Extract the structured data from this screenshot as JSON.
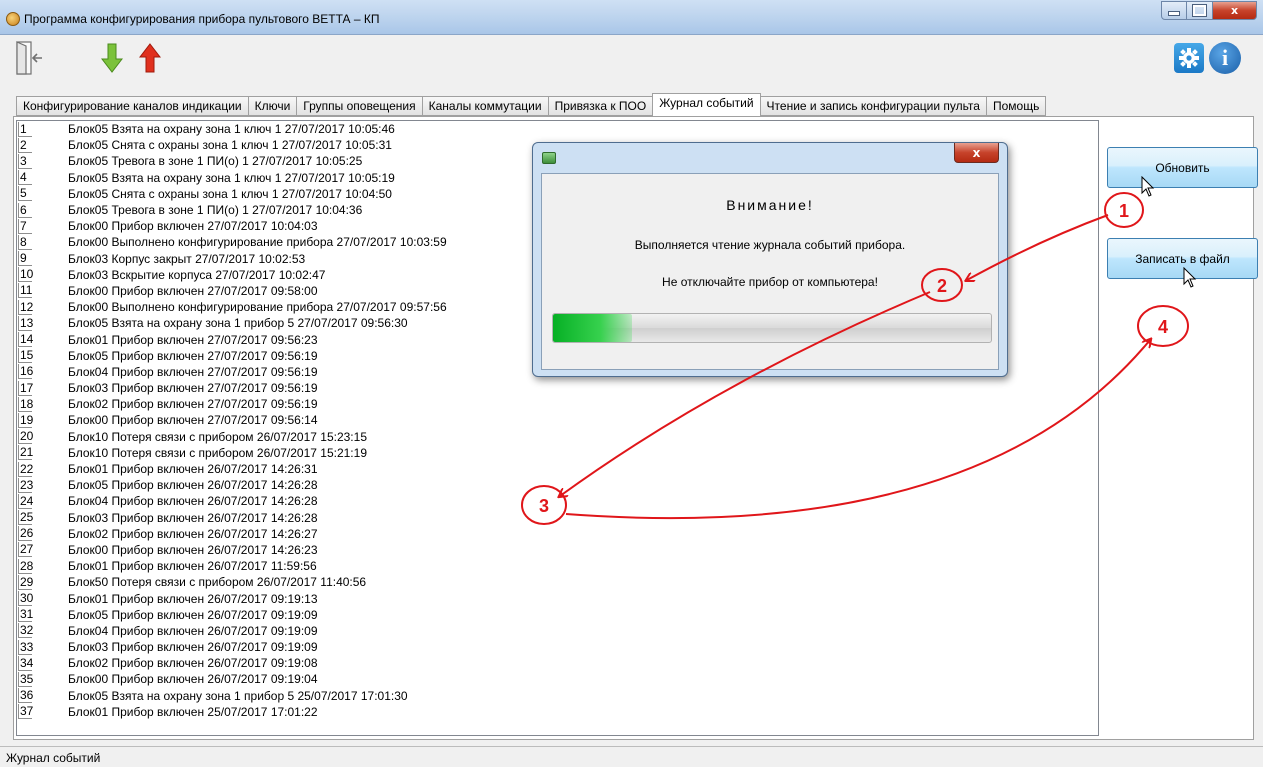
{
  "window": {
    "title": "Программа конфигурирования прибора пультового ВЕТТА – КП",
    "close_symbol": "x"
  },
  "toolbar": {
    "icons": [
      "exit-door-icon",
      "arrow-down-icon",
      "arrow-up-icon",
      "gear-icon",
      "info-icon"
    ],
    "info_symbol": "i",
    "down_color": "#7bc23a",
    "up_color": "#e0301e"
  },
  "tabs": [
    {
      "label": "Конфигурирование каналов индикации"
    },
    {
      "label": "Ключи"
    },
    {
      "label": "Группы оповещения"
    },
    {
      "label": "Каналы коммутации"
    },
    {
      "label": "Привязка к ПОО"
    },
    {
      "label": "Журнал событий",
      "active": true
    },
    {
      "label": "Чтение и запись конфигурации пульта"
    },
    {
      "label": "Помощь"
    }
  ],
  "events": [
    {
      "n": "1",
      "text": "Блок05 Взята на охрану зона 1 ключ 1 27/07/2017 10:05:46"
    },
    {
      "n": "2",
      "text": "Блок05 Снята с охраны зона 1 ключ 1 27/07/2017 10:05:31"
    },
    {
      "n": "3",
      "text": "Блок05 Тревога в зоне 1 ПИ(о) 1 27/07/2017 10:05:25"
    },
    {
      "n": "4",
      "text": "Блок05 Взята на охрану зона 1 ключ 1 27/07/2017 10:05:19"
    },
    {
      "n": "5",
      "text": "Блок05 Снята с охраны зона 1 ключ 1 27/07/2017 10:04:50"
    },
    {
      "n": "6",
      "text": "Блок05 Тревога в зоне 1 ПИ(о) 1 27/07/2017 10:04:36"
    },
    {
      "n": "7",
      "text": "Блок00 Прибор включен 27/07/2017 10:04:03"
    },
    {
      "n": "8",
      "text": "Блок00 Выполнено конфигурирование прибора 27/07/2017 10:03:59"
    },
    {
      "n": "9",
      "text": "Блок03 Корпус закрыт 27/07/2017 10:02:53"
    },
    {
      "n": "10",
      "text": "Блок03 Вскрытие корпуса 27/07/2017 10:02:47"
    },
    {
      "n": "11",
      "text": "Блок00 Прибор включен 27/07/2017 09:58:00"
    },
    {
      "n": "12",
      "text": "Блок00 Выполнено конфигурирование прибора 27/07/2017 09:57:56"
    },
    {
      "n": "13",
      "text": "Блок05 Взята на охрану зона 1 прибор 5 27/07/2017 09:56:30"
    },
    {
      "n": "14",
      "text": "Блок01 Прибор включен 27/07/2017 09:56:23"
    },
    {
      "n": "15",
      "text": "Блок05 Прибор включен 27/07/2017 09:56:19"
    },
    {
      "n": "16",
      "text": "Блок04 Прибор включен 27/07/2017 09:56:19"
    },
    {
      "n": "17",
      "text": "Блок03 Прибор включен 27/07/2017 09:56:19"
    },
    {
      "n": "18",
      "text": "Блок02 Прибор включен 27/07/2017 09:56:19"
    },
    {
      "n": "19",
      "text": "Блок00 Прибор включен 27/07/2017 09:56:14"
    },
    {
      "n": "20",
      "text": "Блок10 Потеря связи с прибором 26/07/2017 15:23:15"
    },
    {
      "n": "21",
      "text": "Блок10 Потеря связи с прибором 26/07/2017 15:21:19"
    },
    {
      "n": "22",
      "text": "Блок01 Прибор включен 26/07/2017 14:26:31"
    },
    {
      "n": "23",
      "text": "Блок05 Прибор включен 26/07/2017 14:26:28"
    },
    {
      "n": "24",
      "text": "Блок04 Прибор включен 26/07/2017 14:26:28"
    },
    {
      "n": "25",
      "text": "Блок03 Прибор включен 26/07/2017 14:26:28"
    },
    {
      "n": "26",
      "text": "Блок02 Прибор включен 26/07/2017 14:26:27"
    },
    {
      "n": "27",
      "text": "Блок00 Прибор включен 26/07/2017 14:26:23"
    },
    {
      "n": "28",
      "text": "Блок01 Прибор включен 26/07/2017 11:59:56"
    },
    {
      "n": "29",
      "text": "Блок50 Потеря связи с прибором 26/07/2017 11:40:56"
    },
    {
      "n": "30",
      "text": "Блок01 Прибор включен 26/07/2017 09:19:13"
    },
    {
      "n": "31",
      "text": "Блок05 Прибор включен 26/07/2017 09:19:09"
    },
    {
      "n": "32",
      "text": "Блок04 Прибор включен 26/07/2017 09:19:09"
    },
    {
      "n": "33",
      "text": "Блок03 Прибор включен 26/07/2017 09:19:09"
    },
    {
      "n": "34",
      "text": "Блок02 Прибор включен 26/07/2017 09:19:08"
    },
    {
      "n": "35",
      "text": "Блок00 Прибор включен 26/07/2017 09:19:04"
    },
    {
      "n": "36",
      "text": "Блок05 Взята на охрану зона 1 прибор 5 25/07/2017 17:01:30"
    },
    {
      "n": "37",
      "text": "Блок01 Прибор включен 25/07/2017 17:01:22"
    }
  ],
  "buttons": {
    "refresh": "Обновить",
    "save_to_file": "Записать в файл"
  },
  "dialog": {
    "close_symbol": "x",
    "heading": "Внимание!",
    "message": "Выполняется чтение журнала событий прибора.",
    "warning": "Не отключайте прибор от компьютера!",
    "progress_fraction": 0.18
  },
  "annotations": {
    "color": "#e0161a",
    "markers": [
      "1",
      "2",
      "3",
      "4"
    ]
  },
  "status_bar": {
    "text": "Журнал событий"
  }
}
